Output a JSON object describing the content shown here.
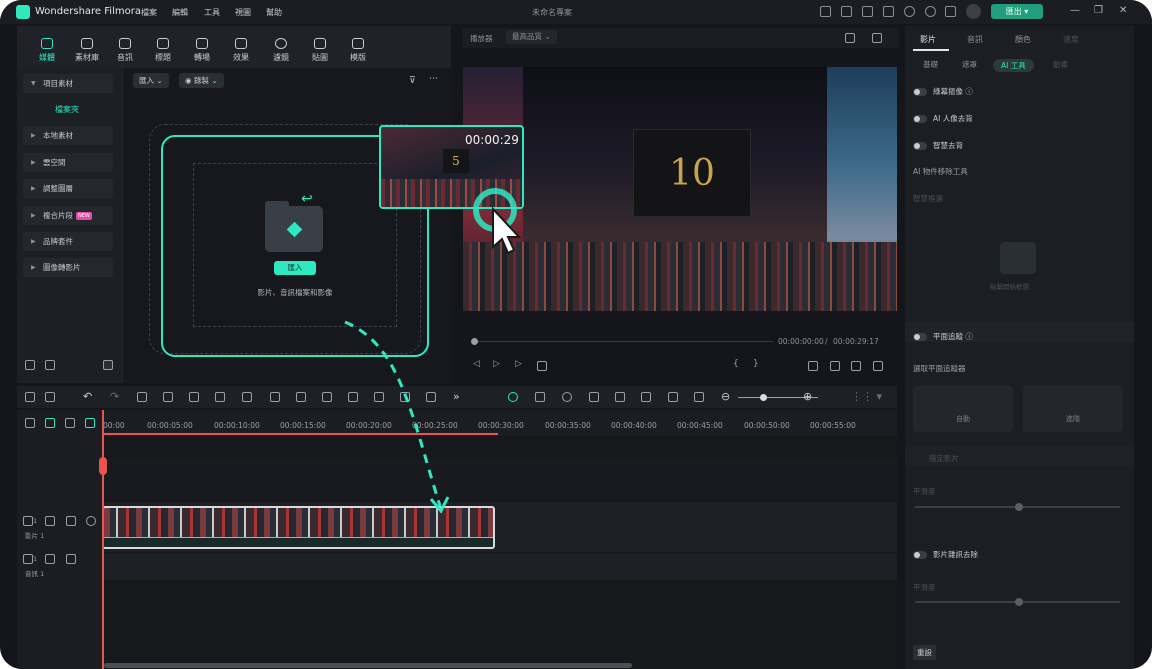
{
  "app": {
    "name": "Wondershare Filmora",
    "doc_title": "未命名專案",
    "menu": [
      "檔案",
      "編輯",
      "工具",
      "視圖",
      "幫助"
    ],
    "export_label": "匯出"
  },
  "media_tabs": [
    {
      "label": "媒體",
      "active": true
    },
    {
      "label": "素材庫",
      "active": false
    },
    {
      "label": "音訊",
      "active": false
    },
    {
      "label": "標題",
      "active": false
    },
    {
      "label": "轉場",
      "active": false
    },
    {
      "label": "效果",
      "active": false
    },
    {
      "label": "濾鏡",
      "active": false
    },
    {
      "label": "貼圖",
      "active": false
    },
    {
      "label": "模版",
      "active": false
    }
  ],
  "sidebar": {
    "items": [
      {
        "label": "項目素材"
      },
      {
        "label": "本地素材"
      },
      {
        "label": "雲空間"
      },
      {
        "label": "調整圖層"
      },
      {
        "label": "複合片段",
        "badge": "NEW"
      },
      {
        "label": "品牌套件"
      },
      {
        "label": "圖像轉影片"
      }
    ],
    "sub_item": "檔案夾"
  },
  "media_area": {
    "import_dropdown": "匯入",
    "record_dropdown": "錄製",
    "import_button": "匯入",
    "import_hint": "影片、音訊檔案和影像"
  },
  "drag_clip": {
    "duration": "00:00:29",
    "sign_number": "5"
  },
  "preview": {
    "player_label": "播放器",
    "quality_label": "最高品質",
    "sign_number": "10",
    "current_time": "00:00:00:00",
    "total_time": "00:00:29:17"
  },
  "right_panel": {
    "tabs": [
      {
        "label": "影片",
        "active": true
      },
      {
        "label": "音訊",
        "active": false
      },
      {
        "label": "顏色",
        "active": false
      },
      {
        "label": "速度",
        "active": false
      }
    ],
    "subtabs": [
      {
        "label": "基礎",
        "active": false
      },
      {
        "label": "遮罩",
        "active": false
      },
      {
        "label": "AI 工具",
        "active": true
      },
      {
        "label": "動畫",
        "active": false
      }
    ],
    "toggles": [
      "綠幕摳像",
      "AI 人像去背",
      "智慧去背"
    ],
    "ai_remove_label": "AI 物件移除工具",
    "smart_label": "智慧框選",
    "smart_box_label": "點擊開始框選",
    "planar_tracking": "平面追蹤",
    "planar_select_label": "選取平面追蹤器",
    "auto_label": "自動",
    "advanced_label": "進階",
    "stabilize_label": "穩定影片",
    "smoothness_label": "平滑度",
    "denoise_label": "影片雜訊去除",
    "denoise_level_label": "平滑度",
    "reset_label": "重設"
  },
  "timeline": {
    "ticks": [
      "00:00",
      "00:00:05:00",
      "00:00:10:00",
      "00:00:15:00",
      "00:00:20:00",
      "00:00:25:00",
      "00:00:30:00",
      "00:00:35:00",
      "00:00:40:00",
      "00:00:45:00",
      "00:00:50:00",
      "00:00:55:00"
    ],
    "video_track_label": "影片 1",
    "audio_track_label": "音訊 1",
    "video_track_num": "1",
    "audio_track_num": "1"
  },
  "colors": {
    "accent": "#2ee8c0",
    "playhead": "#e8544e",
    "background": "#14161b"
  }
}
